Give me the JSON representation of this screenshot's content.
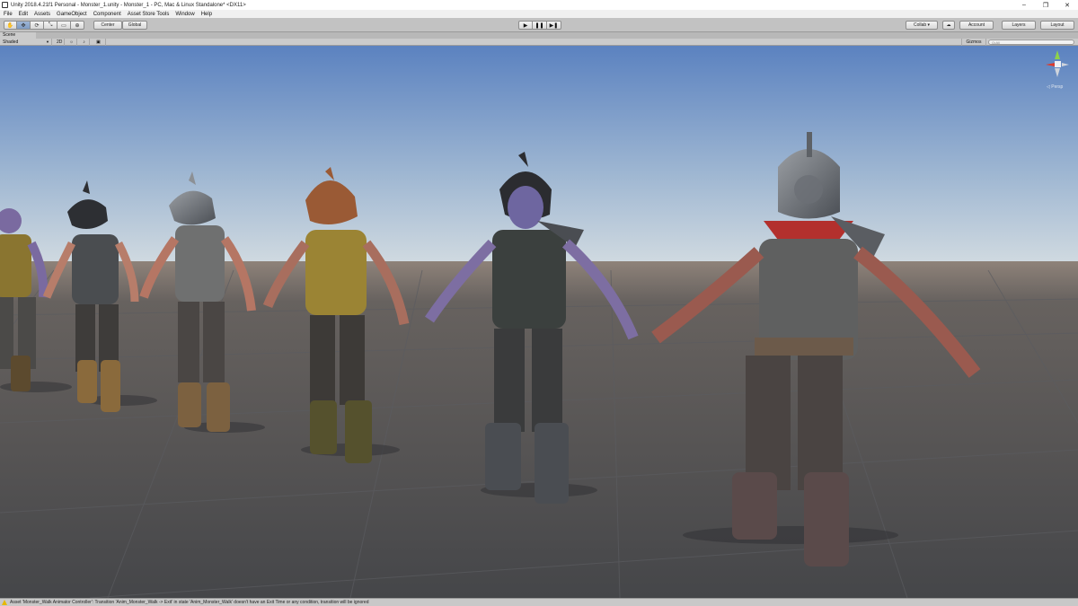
{
  "window": {
    "title": "Unity 2018.4.21f1 Personal - Monster_1.unity - Monster_1 - PC, Mac & Linux Standalone* <DX11>",
    "controls": [
      "–",
      "❐",
      "✕"
    ]
  },
  "menu": [
    "File",
    "Edit",
    "Assets",
    "GameObject",
    "Component",
    "Asset Store Tools",
    "Window",
    "Help"
  ],
  "toolbar": {
    "tools": [
      "hand-tool",
      "move-tool",
      "rotate-tool",
      "scale-tool",
      "rect-tool",
      "transform-tool"
    ],
    "tool_glyphs": [
      "✋",
      "✥",
      "⟳",
      "⤡",
      "▭",
      "⊕"
    ],
    "active_tool": "move-tool",
    "pivot_label": "Center",
    "space_label": "Global",
    "play_glyphs": [
      "▶",
      "❚❚",
      "▶❚"
    ],
    "collab_label": "Collab ▾",
    "cloud_glyph": "☁",
    "account_label": "Account",
    "layers_label": "Layers",
    "layout_label": "Layout"
  },
  "scene": {
    "tab_label": "Scene",
    "shading_mode": "Shaded",
    "mode_2d": "2D",
    "lighting_glyph": "☼",
    "audio_glyph": "♪",
    "effects_glyph": "▣",
    "gizmos_label": "Gizmos",
    "search_placeholder": "Q•All",
    "persp_label": "◁ Persp"
  },
  "status": {
    "message": "Asset 'Monster_Walk Animator Controller': Transition 'Anim_Monster_Walk -> Exit' in state 'Anim_Monster_Walk' doesn't have an Exit Time or any condition, transition will be ignored"
  },
  "colors": {
    "sky_top": "#5e86c2",
    "sky_horizon": "#c9d6e1",
    "ground_far": "#8c8079",
    "ground_near": "#4a4b4e",
    "grid": "#5e5f63",
    "accent_active_tool": "#8aa6cc"
  }
}
